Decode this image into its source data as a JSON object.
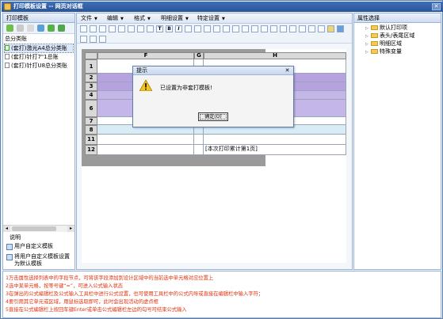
{
  "window": {
    "title": "打印模板设置 -- 网页对话框",
    "close_symbol": "✕"
  },
  "left_panel": {
    "header": "打印模板",
    "group_title": "总分类账",
    "templates": [
      {
        "label": "(套打)激光A4总分类账",
        "selected": true
      },
      {
        "label": "(套打)针打7\"1总账",
        "selected": false
      },
      {
        "label": "(套打)针打U8总分类账",
        "selected": false
      }
    ],
    "description_title": "说明",
    "actions": [
      {
        "label": "用户自定义模板"
      },
      {
        "label": "将用户自定义模板设置为默认模板"
      }
    ]
  },
  "menu": [
    {
      "label": "文件",
      "has_dropdown": true
    },
    {
      "label": "编辑",
      "has_dropdown": true
    },
    {
      "label": "格式",
      "has_dropdown": true
    },
    {
      "label": "明细设置",
      "has_dropdown": true
    },
    {
      "label": "特定设置",
      "has_dropdown": true
    }
  ],
  "toolbar_glyphs": {
    "text_tool": "T",
    "bold_tool": "B",
    "italic_tool": "I"
  },
  "sheet": {
    "columns": [
      "F",
      "G",
      "H"
    ],
    "rows": [
      "1",
      "2",
      "3",
      "4",
      "6",
      "7",
      "8",
      "11",
      "12"
    ],
    "footer_text": "[本次打印累计第1页]"
  },
  "dialog": {
    "title": "提示",
    "message": "已设置为非套打模板!",
    "ok_label": "确定(O)",
    "close_symbol": "✕"
  },
  "right_panel": {
    "header": "属性选择",
    "items": [
      "默认打印项",
      "表头/表尾区域",
      "明细区域",
      "特殊变量"
    ]
  },
  "instructions": [
    "1万击属性选择列表中的字段节点，可将该字段添加到设计区域中的当前选中单元格对应位置上",
    "2选中某单元格，按等号键“=”，可进入公式输入状态",
    "3在弹出的公式编辑栏及公式输入工具栏中进行公式设置，也可使用工具栏中的公式内导或直接在编辑栏中输入字符；",
    "4要引用其它单元或区域，用鼠标选取即可，此时会出现活动的虚点框",
    "5直接在公式编辑栏上按回车键Enter或单击公式编辑栏左边的勾号可结束公式输入"
  ],
  "colors": {
    "title_bar": "#2b5596",
    "purple_cells": "#b7a2e0",
    "instruction_text": "#e0320f"
  }
}
